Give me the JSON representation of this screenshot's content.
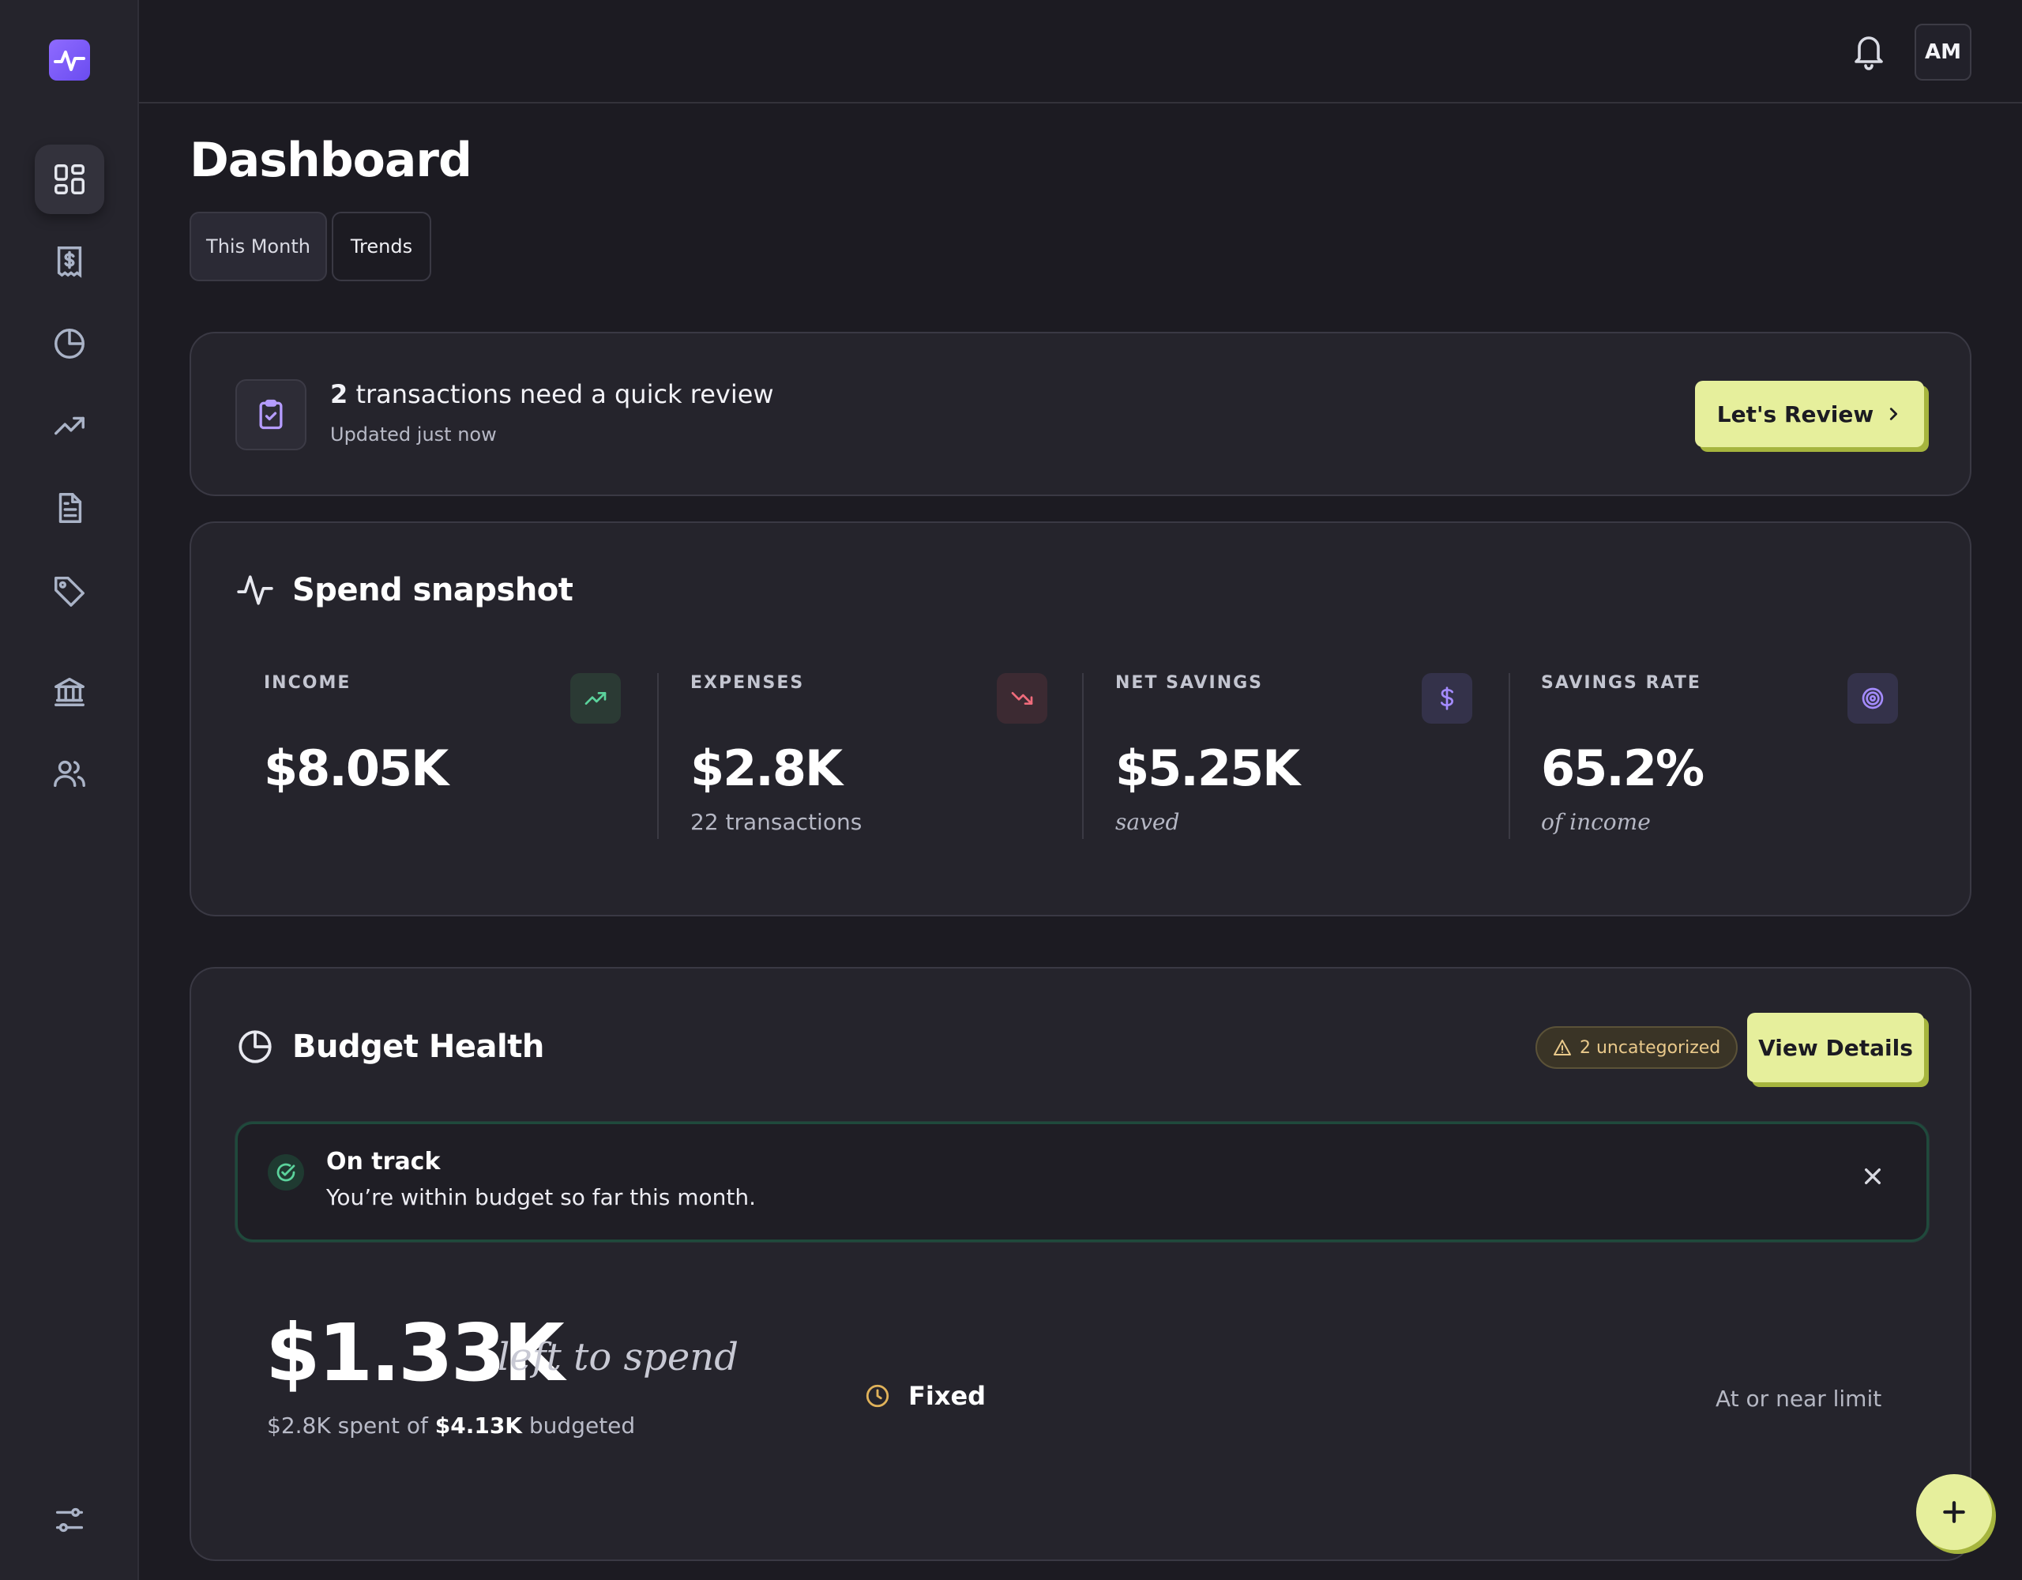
{
  "user": {
    "initials": "AM"
  },
  "page": {
    "title": "Dashboard"
  },
  "tabs": [
    {
      "label": "This Month",
      "active": true
    },
    {
      "label": "Trends",
      "active": false
    }
  ],
  "review": {
    "count": "2",
    "title_rest": " transactions need a quick review",
    "subtitle": "Updated just now",
    "button_label": "Let's Review"
  },
  "snapshot": {
    "title": "Spend snapshot",
    "stats": [
      {
        "label": "INCOME",
        "value": "$8.05K",
        "sub": "",
        "icon": "trending-up-icon",
        "icon_color": "#5bd39c",
        "icon_bg": "#2b3a34"
      },
      {
        "label": "EXPENSES",
        "value": "$2.8K",
        "sub": "22 transactions",
        "icon": "trending-down-icon",
        "icon_color": "#ef6b7b",
        "icon_bg": "#3c2a32"
      },
      {
        "label": "NET SAVINGS",
        "value": "$5.25K",
        "sub": "saved",
        "icon": "dollar-icon",
        "icon_color": "#a48bff",
        "icon_bg": "#34324a"
      },
      {
        "label": "SAVINGS RATE",
        "value": "65.2%",
        "sub": "of income",
        "icon": "target-icon",
        "icon_color": "#a48bff",
        "icon_bg": "#34324a"
      }
    ]
  },
  "budget": {
    "title": "Budget Health",
    "uncategorized_badge": "2 uncategorized",
    "details_button": "View Details",
    "alert_title": "On track",
    "alert_message": "You’re within budget so far this month.",
    "left_amount": "$1.33K",
    "left_label": "left to spend",
    "spent": "$2.8K",
    "spent_mid": " spent of ",
    "budgeted": "$4.13K",
    "budgeted_suffix": " budgeted",
    "group_label": "Fixed",
    "group_status": "At or near limit"
  },
  "colors": {
    "accent_lime": "#e6ef9c",
    "brand_purple": "#7c5cff",
    "success_green": "#5bd39c",
    "warning_amber": "#e9c98b",
    "danger_pink": "#ef6b7b"
  }
}
